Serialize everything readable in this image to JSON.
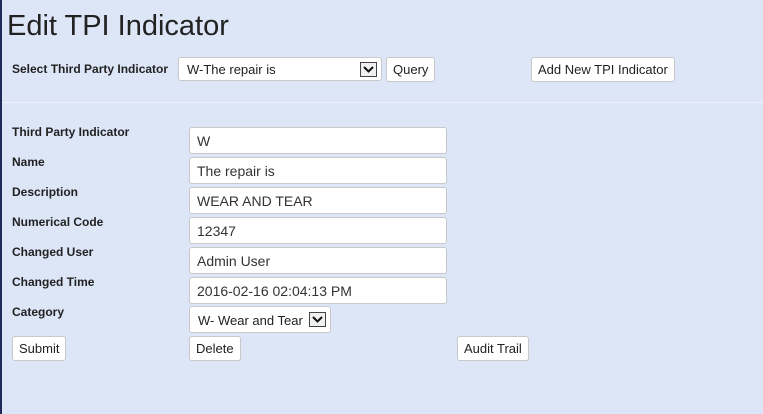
{
  "page": {
    "title": "Edit TPI Indicator"
  },
  "toolbar": {
    "select_label": "Select Third Party Indicator",
    "selected_indicator": "W-The repair is",
    "query_label": "Query",
    "add_new_label": "Add New TPI Indicator"
  },
  "form": {
    "fields": [
      {
        "label": "Third Party Indicator",
        "value": "W"
      },
      {
        "label": "Name",
        "value": "The repair is"
      },
      {
        "label": "Description",
        "value": "WEAR AND TEAR"
      },
      {
        "label": "Numerical Code",
        "value": "12347"
      },
      {
        "label": "Changed User",
        "value": "Admin User"
      },
      {
        "label": "Changed Time",
        "value": "2016-02-16 02:04:13 PM"
      }
    ],
    "category_label": "Category",
    "category_value": "W- Wear and Tear"
  },
  "actions": {
    "submit_label": "Submit",
    "delete_label": "Delete",
    "audit_label": "Audit Trail"
  },
  "colors": {
    "background": "#dce6f7",
    "text": "#222222"
  }
}
